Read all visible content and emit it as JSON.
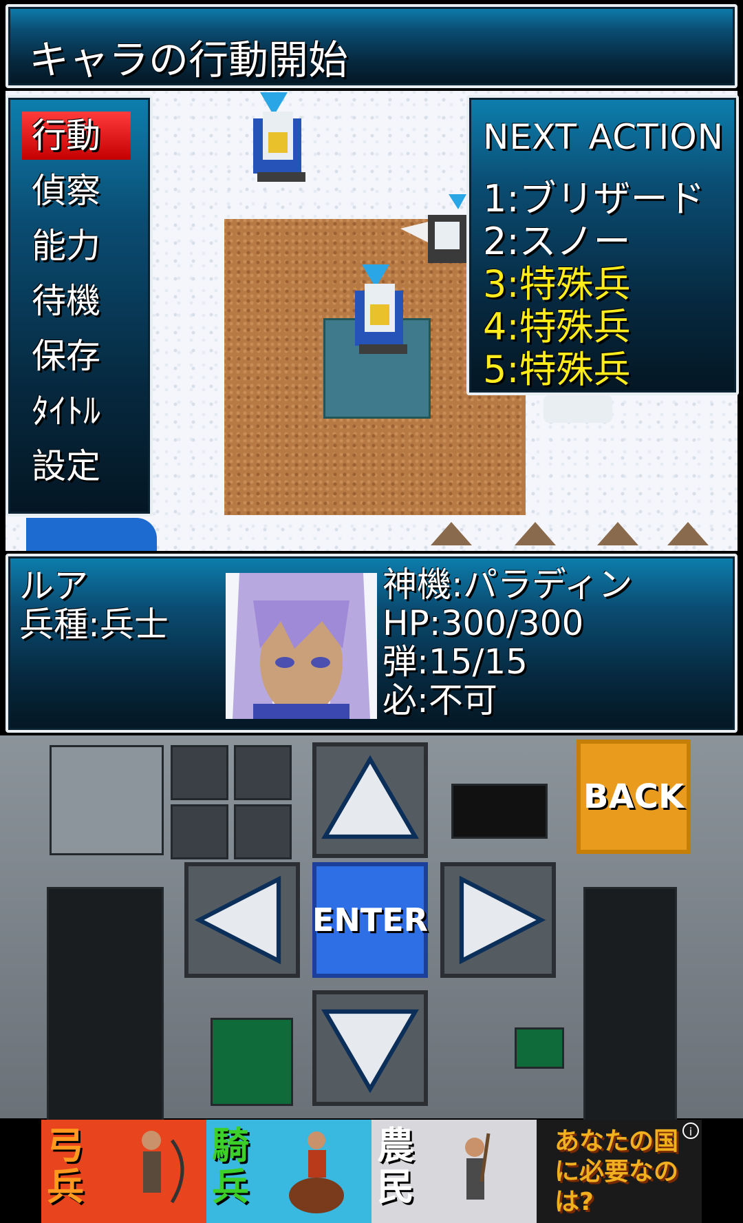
{
  "title": "キャラの行動開始",
  "menu": {
    "items": [
      "行動",
      "偵察",
      "能力",
      "待機",
      "保存",
      "ﾀｲﾄﾙ",
      "設定"
    ],
    "selected_index": 0
  },
  "next_action": {
    "heading": "NEXT ACTION",
    "entries": [
      {
        "text": "1:ブリザード",
        "highlight": false
      },
      {
        "text": "2:スノー",
        "highlight": false
      },
      {
        "text": "3:特殊兵",
        "highlight": true
      },
      {
        "text": "4:特殊兵",
        "highlight": true
      },
      {
        "text": "5:特殊兵",
        "highlight": true
      }
    ]
  },
  "status": {
    "name": "ルア",
    "class": "兵種:兵士",
    "mech": "神機:パラディン",
    "hp": "HP:300/300",
    "ammo": "弾:15/15",
    "special": "必:不可"
  },
  "controls": {
    "up_icon": "arrow-up-icon",
    "down_icon": "arrow-down-icon",
    "left_icon": "arrow-left-icon",
    "right_icon": "arrow-right-icon",
    "enter_label": "ENTER",
    "back_label": "BACK"
  },
  "ad": {
    "cells": [
      {
        "word": "弓兵",
        "color": "#ff9a1f"
      },
      {
        "word": "騎兵",
        "color": "#3ccf2a"
      },
      {
        "word": "農民",
        "color": "#ffffff"
      }
    ],
    "slogan": "あなたの国に必要なのは?",
    "info_icon": "info-icon"
  },
  "colors": {
    "panel_top": "#0d7fae",
    "panel_bottom": "#041623",
    "menu_selected": "#e01414",
    "highlight_text": "#ffec1c",
    "enter_button": "#2f6fe6",
    "back_button": "#e89b1d"
  }
}
